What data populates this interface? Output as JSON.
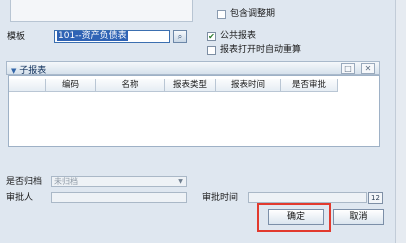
{
  "options": {
    "include_adjust_period_label": "包含调整期",
    "public_report_label": "公共报表",
    "public_report_checked": true,
    "auto_recalc_label": "报表打开时自动重算",
    "auto_recalc_checked": false
  },
  "template": {
    "label": "模板",
    "value": "101--资产负债表"
  },
  "subreport": {
    "title": "子报表",
    "columns": [
      "编码",
      "名称",
      "报表类型",
      "报表时间",
      "是否审批"
    ]
  },
  "archive": {
    "label": "是否归档",
    "value": "未归档"
  },
  "approval": {
    "approver_label": "审批人",
    "time_label": "审批时间"
  },
  "buttons": {
    "ok": "确定",
    "cancel": "取消"
  }
}
